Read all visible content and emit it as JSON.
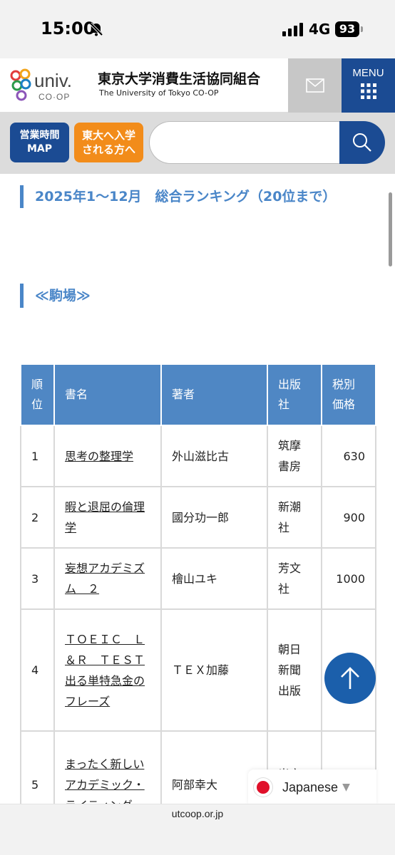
{
  "status_bar": {
    "time": "15:00",
    "network": "4G",
    "battery": "93"
  },
  "header": {
    "logo_text": "UNIV. CO-OP",
    "org_name": "東京大学消費生活協同組合",
    "org_sub": "The University of Tokyo CO-OP",
    "menu_label": "MENU"
  },
  "search": {
    "hours_button": {
      "line1": "営業時間",
      "line2": "MAP"
    },
    "admission_button": {
      "line1": "東大へ入学",
      "line2": "される方へ"
    },
    "placeholder": ""
  },
  "content": {
    "page_heading": "2025年1〜12月　総合ランキング（20位まで）",
    "section_heading": "≪駒場≫"
  },
  "table": {
    "headers": [
      "順位",
      "書名",
      "著者",
      "出版社",
      "税別価格"
    ],
    "rows": [
      {
        "rank": "1",
        "title": "思考の整理学",
        "author": "外山滋比古",
        "publisher": "筑摩書房",
        "price": "630"
      },
      {
        "rank": "2",
        "title": "暇と退屈の倫理学",
        "author": "國分功一郎",
        "publisher": "新潮社",
        "price": "900"
      },
      {
        "rank": "3",
        "title": "妄想アカデミズム　２",
        "author": "檜山ユキ",
        "publisher": "芳文社",
        "price": "1000"
      },
      {
        "rank": "4",
        "title": "ＴＯＥＩＣ　Ｌ＆Ｒ　ＴＥＳＴ出る単特急金のフレーズ",
        "author": "ＴＥＸ加藤",
        "publisher": "朝日新聞出版",
        "price": ""
      },
      {
        "rank": "5",
        "title": "まったく新しいアカデミック・ライティング",
        "author": "阿部幸大",
        "publisher": "光文社",
        "price": ""
      }
    ]
  },
  "language": {
    "label": "Japanese"
  },
  "url_bar": {
    "url": "utcoop.or.jp"
  },
  "colors": {
    "brand_blue": "#1b4b93",
    "heading_blue": "#4a86c8",
    "accent_orange": "#f28c1a"
  }
}
